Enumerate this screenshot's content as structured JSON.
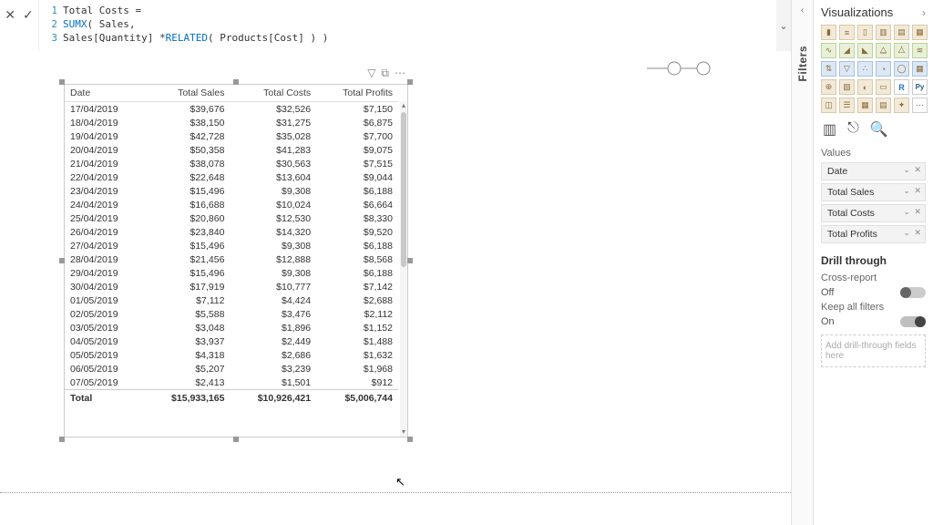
{
  "formula": {
    "line1_lineno": "1",
    "line1_prefix": "Total Costs = ",
    "line2_lineno": "2",
    "line2_fn": "SUMX",
    "line2_rest": "( Sales,",
    "line3_lineno": "3",
    "line3_indent": "    Sales[Quantity] * ",
    "line3_fn": "RELATED",
    "line3_rest": "( Products[Cost] ) )"
  },
  "table": {
    "headers": [
      "Date",
      "Total Sales",
      "Total Costs",
      "Total Profits"
    ],
    "rows": [
      [
        "17/04/2019",
        "$39,676",
        "$32,526",
        "$7,150"
      ],
      [
        "18/04/2019",
        "$38,150",
        "$31,275",
        "$6,875"
      ],
      [
        "19/04/2019",
        "$42,728",
        "$35,028",
        "$7,700"
      ],
      [
        "20/04/2019",
        "$50,358",
        "$41,283",
        "$9,075"
      ],
      [
        "21/04/2019",
        "$38,078",
        "$30,563",
        "$7,515"
      ],
      [
        "22/04/2019",
        "$22,648",
        "$13,604",
        "$9,044"
      ],
      [
        "23/04/2019",
        "$15,496",
        "$9,308",
        "$6,188"
      ],
      [
        "24/04/2019",
        "$16,688",
        "$10,024",
        "$6,664"
      ],
      [
        "25/04/2019",
        "$20,860",
        "$12,530",
        "$8,330"
      ],
      [
        "26/04/2019",
        "$23,840",
        "$14,320",
        "$9,520"
      ],
      [
        "27/04/2019",
        "$15,496",
        "$9,308",
        "$6,188"
      ],
      [
        "28/04/2019",
        "$21,456",
        "$12,888",
        "$8,568"
      ],
      [
        "29/04/2019",
        "$15,496",
        "$9,308",
        "$6,188"
      ],
      [
        "30/04/2019",
        "$17,919",
        "$10,777",
        "$7,142"
      ],
      [
        "01/05/2019",
        "$7,112",
        "$4,424",
        "$2,688"
      ],
      [
        "02/05/2019",
        "$5,588",
        "$3,476",
        "$2,112"
      ],
      [
        "03/05/2019",
        "$3,048",
        "$1,896",
        "$1,152"
      ],
      [
        "04/05/2019",
        "$3,937",
        "$2,449",
        "$1,488"
      ],
      [
        "05/05/2019",
        "$4,318",
        "$2,686",
        "$1,632"
      ],
      [
        "06/05/2019",
        "$5,207",
        "$3,239",
        "$1,968"
      ],
      [
        "07/05/2019",
        "$2,413",
        "$1,501",
        "$912"
      ]
    ],
    "total": [
      "Total",
      "$15,933,165",
      "$10,926,421",
      "$5,006,744"
    ]
  },
  "viz_pane": {
    "title": "Visualizations",
    "values_label": "Values",
    "fields": [
      "Date",
      "Total Sales",
      "Total Costs",
      "Total Profits"
    ],
    "drill_header": "Drill through",
    "cross_report_label": "Cross-report",
    "cross_report_state": "Off",
    "keep_filters_label": "Keep all filters",
    "keep_filters_state": "On",
    "drill_drop": "Add drill-through fields here"
  },
  "filters_pane": {
    "label": "Filters"
  },
  "chart_data": {
    "type": "table",
    "columns": [
      "Date",
      "Total Sales",
      "Total Costs",
      "Total Profits"
    ],
    "rows": [
      [
        "17/04/2019",
        39676,
        32526,
        7150
      ],
      [
        "18/04/2019",
        38150,
        31275,
        6875
      ],
      [
        "19/04/2019",
        42728,
        35028,
        7700
      ],
      [
        "20/04/2019",
        50358,
        41283,
        9075
      ],
      [
        "21/04/2019",
        38078,
        30563,
        7515
      ],
      [
        "22/04/2019",
        22648,
        13604,
        9044
      ],
      [
        "23/04/2019",
        15496,
        9308,
        6188
      ],
      [
        "24/04/2019",
        16688,
        10024,
        6664
      ],
      [
        "25/04/2019",
        20860,
        12530,
        8330
      ],
      [
        "26/04/2019",
        23840,
        14320,
        9520
      ],
      [
        "27/04/2019",
        15496,
        9308,
        6188
      ],
      [
        "28/04/2019",
        21456,
        12888,
        8568
      ],
      [
        "29/04/2019",
        15496,
        9308,
        6188
      ],
      [
        "30/04/2019",
        17919,
        10777,
        7142
      ],
      [
        "01/05/2019",
        7112,
        4424,
        2688
      ],
      [
        "02/05/2019",
        5588,
        3476,
        2112
      ],
      [
        "03/05/2019",
        3048,
        1896,
        1152
      ],
      [
        "04/05/2019",
        3937,
        2449,
        1488
      ],
      [
        "05/05/2019",
        4318,
        2686,
        1632
      ],
      [
        "06/05/2019",
        5207,
        3239,
        1968
      ],
      [
        "07/05/2019",
        2413,
        1501,
        912
      ]
    ],
    "totals": {
      "Total Sales": 15933165,
      "Total Costs": 10926421,
      "Total Profits": 5006744
    }
  }
}
